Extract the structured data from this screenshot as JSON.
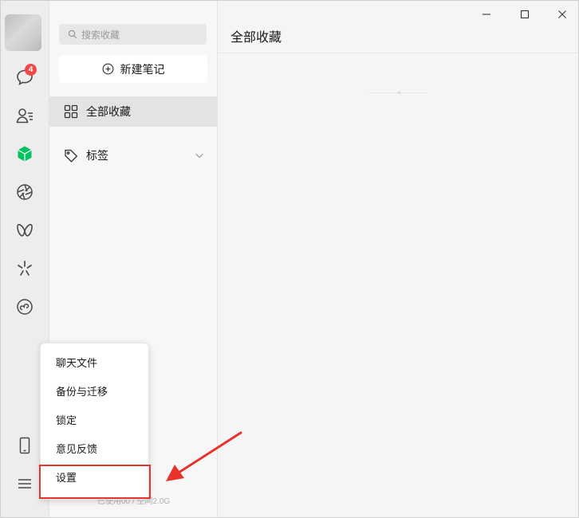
{
  "window": {
    "controls": [
      "minimize-icon",
      "maximize-icon",
      "close-icon"
    ]
  },
  "rail": {
    "badge_count": "4",
    "icons": [
      "chat-icon",
      "contacts-icon",
      "favorites-cube-icon",
      "moments-aperture-icon",
      "channels-butterfly-icon",
      "search-sparkle-icon",
      "mini-program-icon",
      "phone-icon",
      "menu-icon"
    ],
    "accent_color": "#07c160",
    "badge_color": "#f04848"
  },
  "sidebar": {
    "search_placeholder": "搜索收藏",
    "new_note_label": "新建笔记",
    "items": [
      {
        "label": "全部收藏",
        "icon": "grid-icon"
      },
      {
        "label": "标签",
        "icon": "tag-icon"
      }
    ],
    "storage_text": "已使用00 / 空间2.0G"
  },
  "content": {
    "title": "全部收藏"
  },
  "menu": {
    "items": [
      "聊天文件",
      "备份与迁移",
      "锁定",
      "意见反馈",
      "设置"
    ],
    "highlight_color": "#e8322c"
  }
}
